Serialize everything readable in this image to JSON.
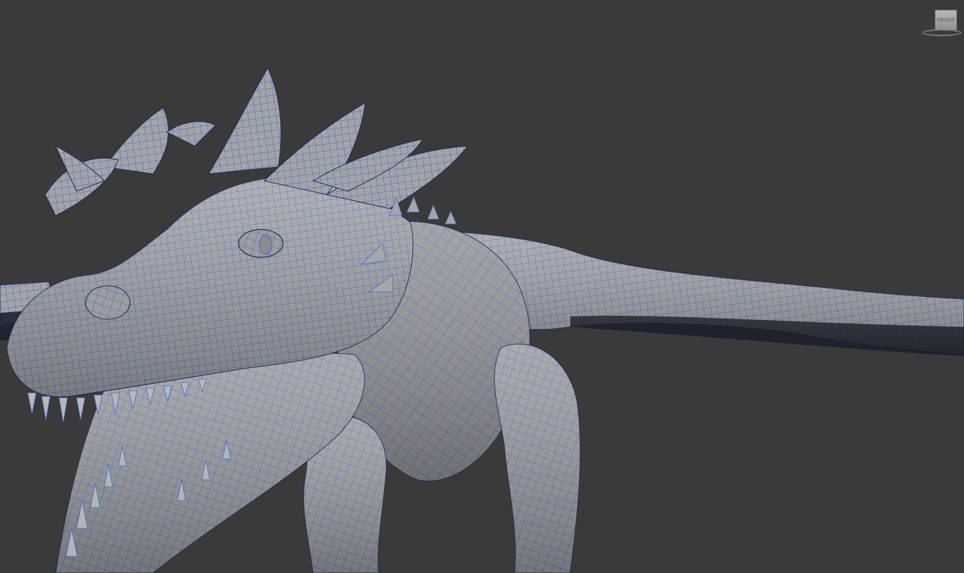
{
  "viewport": {
    "background": "#3a3a3a",
    "model_color": "#9c9c9c",
    "wire_color": "#3a66e0"
  },
  "viewcube": {
    "face_label": "FRONT"
  }
}
